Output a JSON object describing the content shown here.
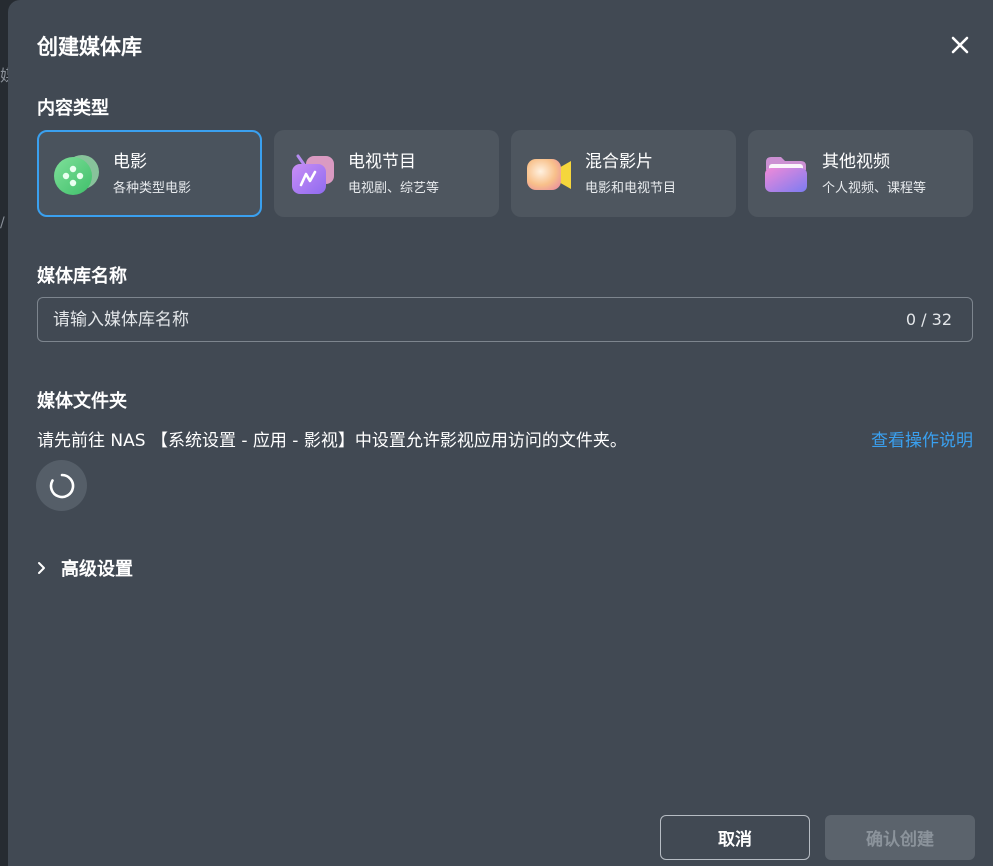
{
  "dialog": {
    "title": "创建媒体库"
  },
  "content_type": {
    "label": "内容类型",
    "cards": [
      {
        "title": "电影",
        "subtitle": "各种类型电影",
        "icon": "film-reel-icon",
        "selected": true
      },
      {
        "title": "电视节目",
        "subtitle": "电视剧、综艺等",
        "icon": "tv-icon",
        "selected": false
      },
      {
        "title": "混合影片",
        "subtitle": "电影和电视节目",
        "icon": "video-camera-icon",
        "selected": false
      },
      {
        "title": "其他视频",
        "subtitle": "个人视频、课程等",
        "icon": "folder-icon",
        "selected": false
      }
    ]
  },
  "library_name": {
    "label": "媒体库名称",
    "placeholder": "请输入媒体库名称",
    "value": "",
    "counter": "0 / 32"
  },
  "media_folder": {
    "label": "媒体文件夹",
    "hint": "请先前往 NAS 【系统设置 - 应用 - 影视】中设置允许影视应用访问的文件夹。",
    "help_link": "查看操作说明",
    "loading": true
  },
  "advanced": {
    "label": "高级设置",
    "expanded": false
  },
  "footer": {
    "cancel_label": "取消",
    "confirm_label": "确认创建",
    "confirm_enabled": false
  },
  "colors": {
    "accent": "#3aa0ef",
    "dialog_bg": "#414953",
    "card_bg": "#4e565f"
  },
  "background": {
    "glyph_1": "媒",
    "glyph_2": "/"
  }
}
